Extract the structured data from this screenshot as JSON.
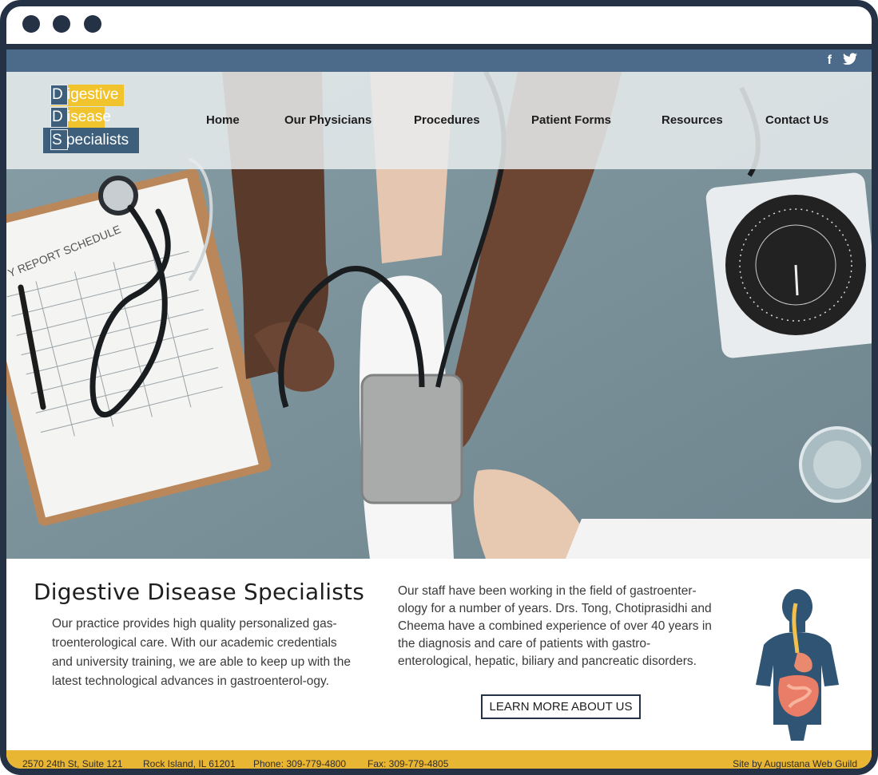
{
  "social": {
    "facebook": "f",
    "twitter": "🐦"
  },
  "logo": {
    "line1_initial": "D",
    "line1_rest": "igestive",
    "line2_initial": "D",
    "line2_rest": "isease",
    "line3_initial": "S",
    "line3_rest": "pecialists"
  },
  "nav": [
    "Home",
    "Our Physicians",
    "Procedures",
    "Patient Forms",
    "Resources",
    "Contact Us"
  ],
  "hero": {
    "clipboard_text": "Y REPORT SCHEDULE"
  },
  "main": {
    "title": "Digestive Disease Specialists",
    "left_text": "Our practice provides high quality personalized gas-troenterological care. With our academic credentials and university training, we are able to keep up with the latest technological advances in gastroenterol-ogy.",
    "right_text": "Our staff have been working in the field of gastroenter-ology for a number of years. Drs. Tong, Chotiprasidhi and Cheema have a combined experience of over 40 years in the diagnosis and care of patients with gastro-enterological, hepatic, biliary and pancreatic disorders.",
    "button": "LEARN MORE ABOUT US"
  },
  "footer": {
    "address": "2570 24th St, Suite 121",
    "city": "Rock Island, IL 61201",
    "phone": "Phone: 309-779-4800",
    "fax": "Fax: 309-779-4805",
    "credit": "Site by Augustana Web Guild"
  },
  "colors": {
    "frame": "#253246",
    "topbar": "#4c6b8a",
    "footer": "#e9b634",
    "logo_yellow": "#f1c32c",
    "logo_blue": "#3d5f7c"
  }
}
